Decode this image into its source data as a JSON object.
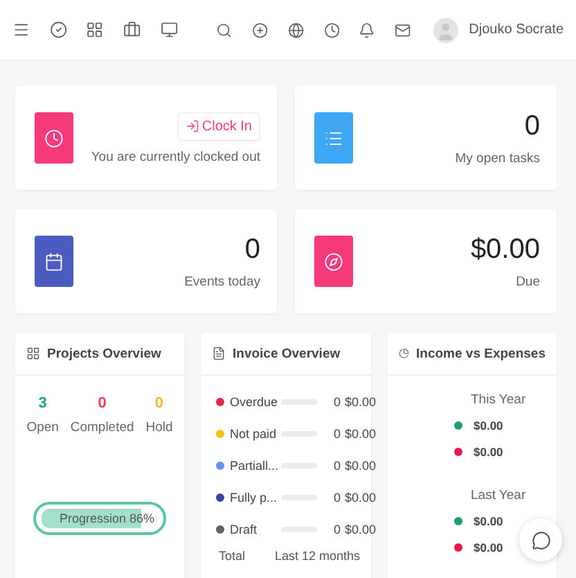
{
  "header": {
    "left_icons": [
      {
        "kind": "menu"
      },
      {
        "kind": "check"
      },
      {
        "kind": "grid"
      },
      {
        "kind": "briefcase"
      },
      {
        "kind": "monitor"
      }
    ],
    "right_icons": [
      {
        "kind": "search"
      },
      {
        "kind": "plus"
      },
      {
        "kind": "globe"
      },
      {
        "kind": "clock"
      },
      {
        "kind": "bell"
      },
      {
        "kind": "mail"
      }
    ],
    "user": {
      "name": "Djouko Socrate"
    }
  },
  "stat_cards": [
    {
      "kind": "clock",
      "color": "#f5397b",
      "button": "Clock In",
      "label": "You are currently clocked out"
    },
    {
      "kind": "list",
      "color": "#3ea7f5",
      "value": "0",
      "label": "My open tasks"
    },
    {
      "kind": "calendar",
      "color": "#4a5cc0",
      "value": "0",
      "label": "Events today"
    },
    {
      "kind": "compass",
      "color": "#f5397b",
      "value": "$0.00",
      "label": "Due"
    }
  ],
  "projects": {
    "title": "Projects Overview",
    "stats": [
      {
        "value": "3",
        "label": "Open",
        "color": "#1aa486"
      },
      {
        "value": "0",
        "label": "Completed",
        "color": "#f5395a"
      },
      {
        "value": "0",
        "label": "Hold",
        "color": "#f7b630"
      }
    ],
    "progress": {
      "label": "Progression 86%",
      "level": 0.86
    }
  },
  "invoices": {
    "title": "Invoice Overview",
    "rows": [
      {
        "label": "Overdue",
        "color": "#e8264d",
        "count": "0",
        "amount": "$0.00"
      },
      {
        "label": "Not paid",
        "color": "#f5c211",
        "count": "0",
        "amount": "$0.00"
      },
      {
        "label": "Partiall...",
        "color": "#6a8ff5",
        "count": "0",
        "amount": "$0.00"
      },
      {
        "label": "Fully p...",
        "color": "#3a44a8",
        "count": "0",
        "amount": "$0.00"
      },
      {
        "label": "Draft",
        "color": "#5f6368",
        "count": "0",
        "amount": "$0.00"
      }
    ],
    "footer": [
      "Total",
      "Last 12 months"
    ]
  },
  "income": {
    "title": "Income vs Expenses",
    "groups": [
      {
        "label": "This Year",
        "items": [
          {
            "color": "#1f9d78",
            "amount": "$0.00"
          },
          {
            "color": "#e8164d",
            "amount": "$0.00"
          }
        ]
      },
      {
        "label": "Last Year",
        "items": [
          {
            "color": "#1f9d78",
            "amount": "$0.00"
          },
          {
            "color": "#e8164d",
            "amount": "$0.00"
          }
        ]
      }
    ]
  }
}
